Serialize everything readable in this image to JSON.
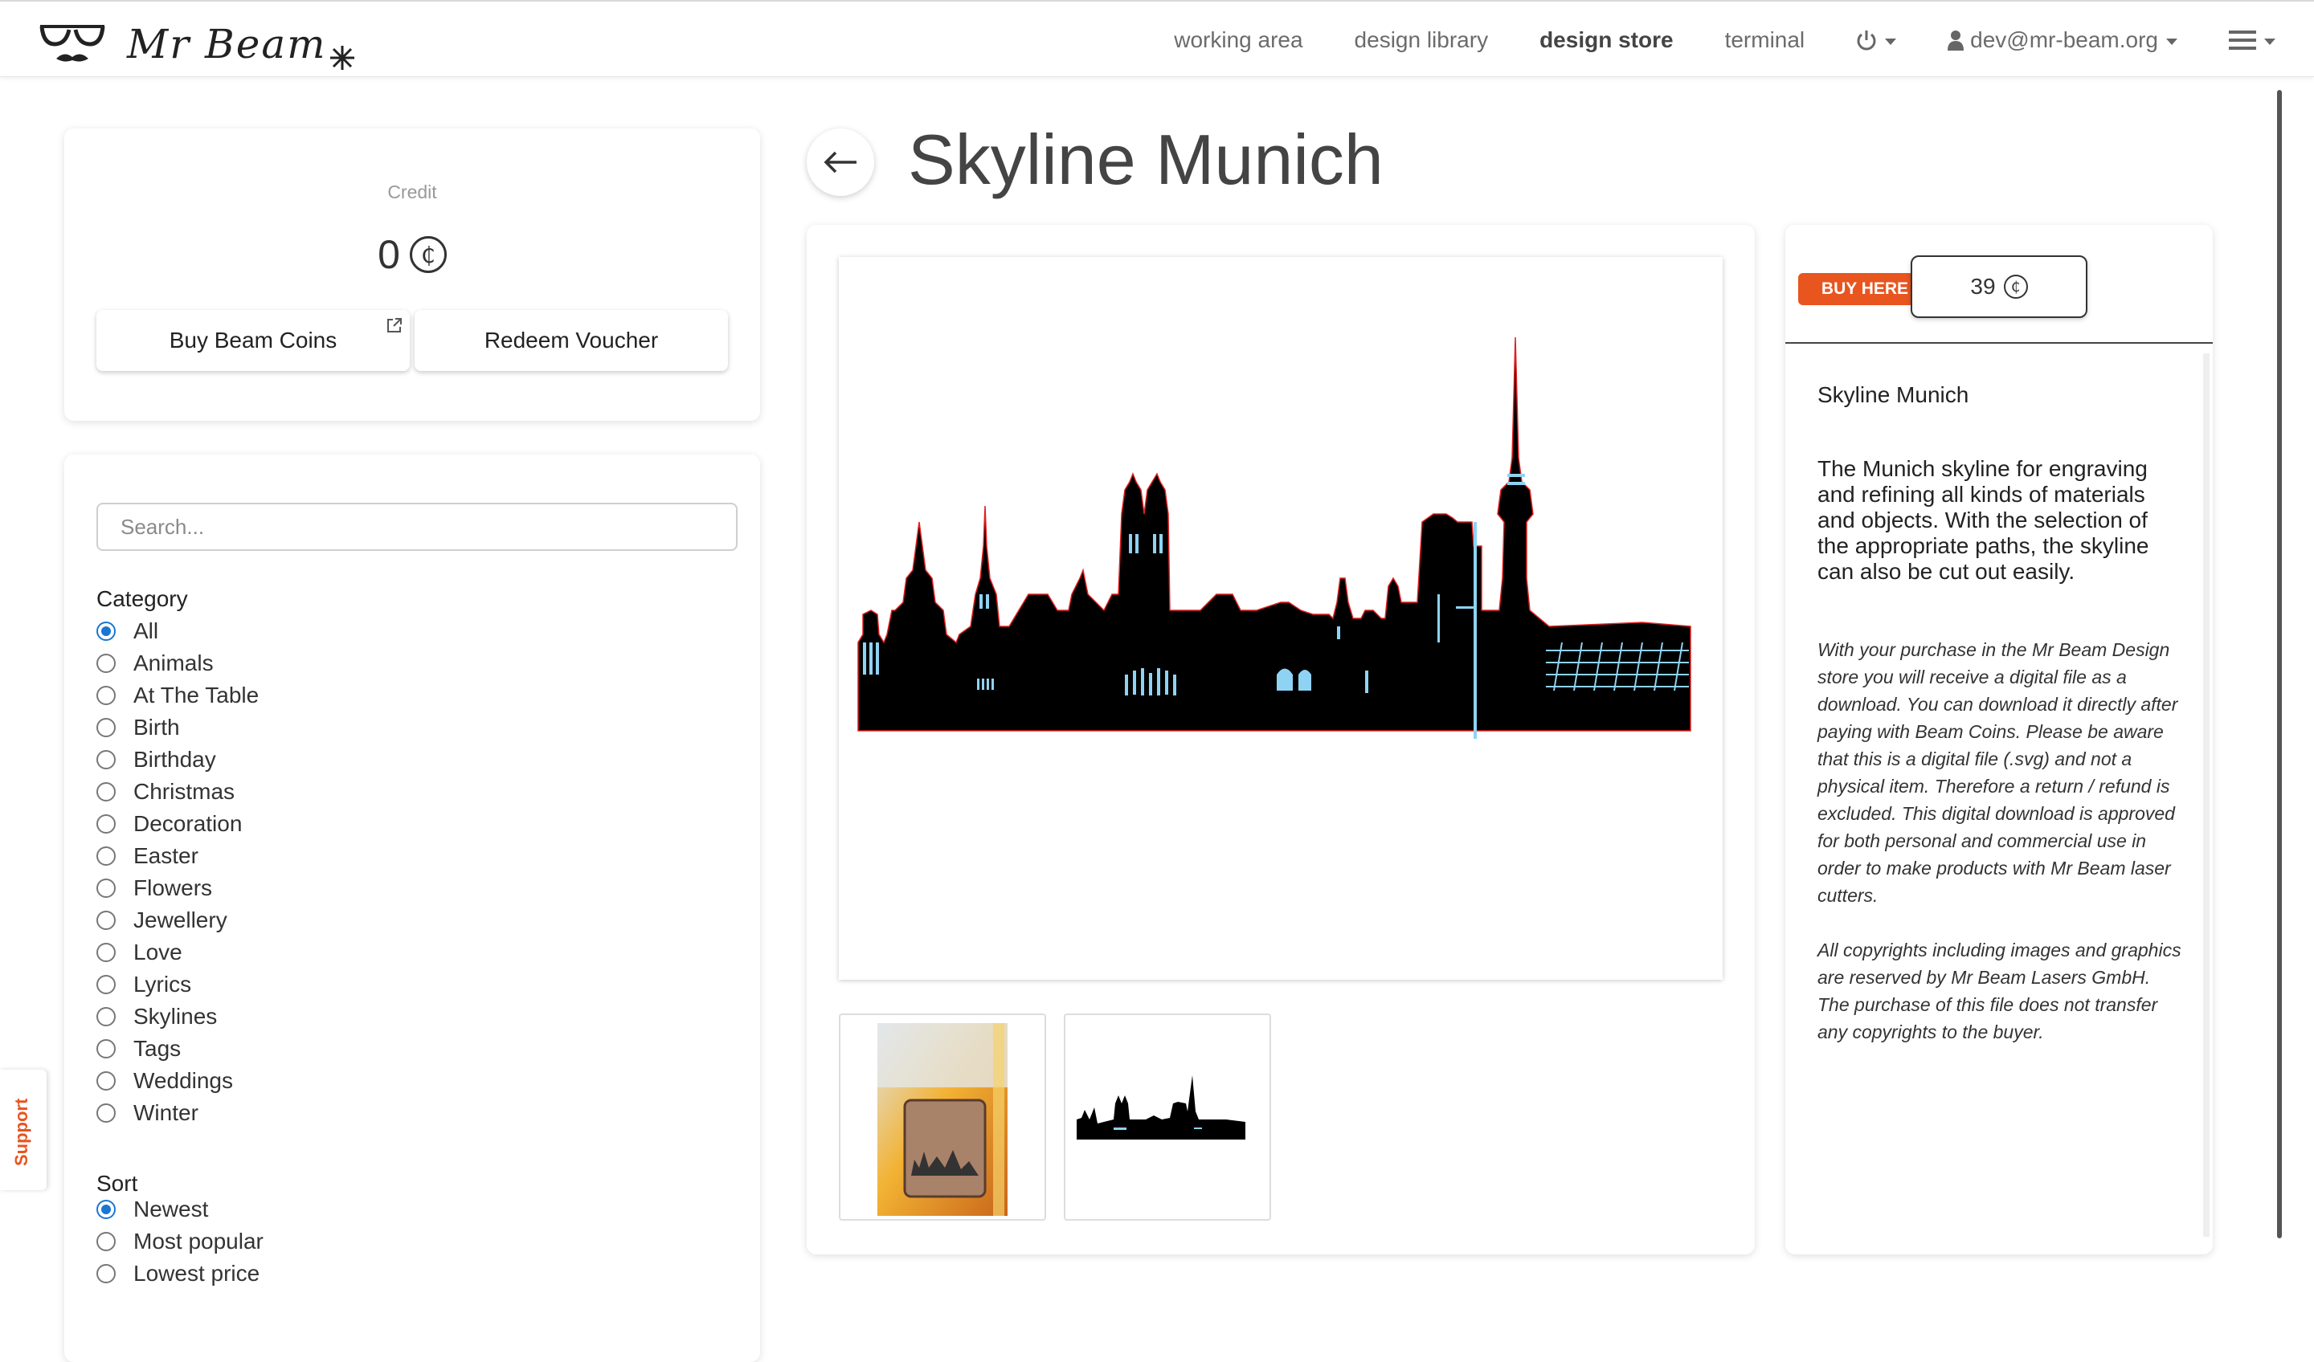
{
  "nav": {
    "working_area": "working area",
    "design_library": "design library",
    "design_store": "design store",
    "terminal": "terminal",
    "user": "dev@mr-beam.org"
  },
  "brand": {
    "name": "Mr Beam"
  },
  "credit": {
    "label": "Credit",
    "value": "0",
    "currency_symbol": "₵",
    "buy_label": "Buy Beam Coins",
    "redeem_label": "Redeem Voucher"
  },
  "filters": {
    "search_placeholder": "Search...",
    "category_heading": "Category",
    "categories": [
      "All",
      "Animals",
      "At The Table",
      "Birth",
      "Birthday",
      "Christmas",
      "Decoration",
      "Easter",
      "Flowers",
      "Jewellery",
      "Love",
      "Lyrics",
      "Skylines",
      "Tags",
      "Weddings",
      "Winter"
    ],
    "selected_category": "All",
    "sort_heading": "Sort",
    "sort_options": [
      "Newest",
      "Most popular",
      "Lowest price"
    ],
    "selected_sort": "Newest"
  },
  "support": {
    "label": "Support"
  },
  "product": {
    "title": "Skyline Munich",
    "buy_here": "BUY HERE",
    "price": "39",
    "name": "Skyline Munich",
    "description": "The Munich skyline for engraving and refining all kinds of materials and objects. With the selection of the appropriate paths, the skyline can also be cut out easily.",
    "legal": "With your purchase in the Mr Beam Design store you will receive a digital file as a download. You can download it directly after paying with Beam Coins. Please be aware that this is a digital file (.svg) and not a physical item. Therefore a return / refund is excluded. This digital download is approved for both personal and commercial use in order to make products with Mr Beam laser cutters.",
    "copyright": "All copyrights including images and graphics are reserved by Mr Beam Lasers GmbH. The purchase of this file does not transfer any copyrights to the buyer."
  },
  "colors": {
    "accent": "#e8551f",
    "radio": "#1976d2"
  }
}
